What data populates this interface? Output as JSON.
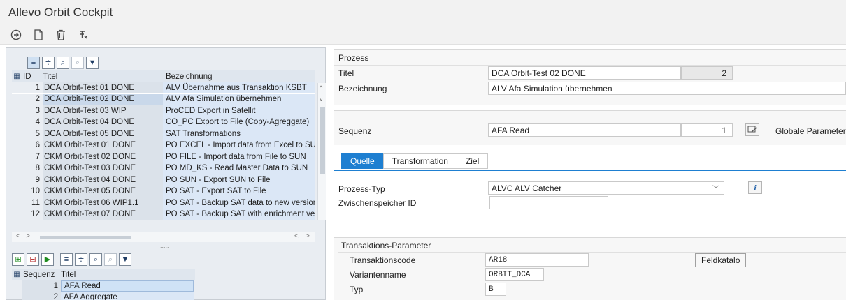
{
  "app": {
    "title": "Allevo Orbit Cockpit"
  },
  "proc_table": {
    "headers": {
      "id": "ID",
      "titel": "Titel",
      "bezeichnung": "Bezeichnung"
    },
    "rows": [
      {
        "id": "1",
        "titel": "DCA Orbit-Test 01 DONE",
        "bezeichnung": "ALV Übernahme aus Transaktion KSBT"
      },
      {
        "id": "2",
        "titel": "DCA Orbit-Test 02 DONE",
        "bezeichnung": "ALV Afa Simulation übernehmen"
      },
      {
        "id": "3",
        "titel": "DCA Orbit-Test 03 WIP",
        "bezeichnung": "ProCED Export in Satellit"
      },
      {
        "id": "4",
        "titel": "DCA Orbit-Test 04 DONE",
        "bezeichnung": "CO_PC Export to File (Copy-Agreggate)"
      },
      {
        "id": "5",
        "titel": "DCA Orbit-Test 05 DONE",
        "bezeichnung": "SAT Transformations"
      },
      {
        "id": "6",
        "titel": "CKM Orbit-Test 01 DONE",
        "bezeichnung": "PO EXCEL - Import data from Excel to SUN"
      },
      {
        "id": "7",
        "titel": "CKM Orbit-Test 02 DONE",
        "bezeichnung": "PO FILE - Import data from File to SUN"
      },
      {
        "id": "8",
        "titel": "CKM Orbit-Test 03 DONE",
        "bezeichnung": "PO MD_KS - Read Master Data to SUN"
      },
      {
        "id": "9",
        "titel": "CKM Orbit-Test 04 DONE",
        "bezeichnung": "PO SUN - Export SUN to File"
      },
      {
        "id": "10",
        "titel": "CKM Orbit-Test 05 DONE",
        "bezeichnung": "PO SAT - Export SAT to File"
      },
      {
        "id": "11",
        "titel": "CKM Orbit-Test 06 WIP1.1",
        "bezeichnung": "PO SAT - Backup SAT data to new version"
      },
      {
        "id": "12",
        "titel": "CKM Orbit-Test 07 DONE",
        "bezeichnung": "PO SAT - Backup SAT with enrichment ver"
      }
    ]
  },
  "seq_table": {
    "headers": {
      "sequenz": "Sequenz",
      "titel": "Titel"
    },
    "rows": [
      {
        "num": "1",
        "titel": "AFA Read"
      },
      {
        "num": "2",
        "titel": "AFA Aggregate"
      }
    ]
  },
  "prozess": {
    "section_title": "Prozess",
    "titel_label": "Titel",
    "titel_value": "DCA Orbit-Test 02 DONE",
    "titel_num": "2",
    "bez_label": "Bezeichnung",
    "bez_value": "ALV Afa Simulation übernehmen"
  },
  "sequenz": {
    "label": "Sequenz",
    "value": "AFA Read",
    "num": "1",
    "globale_label": "Globale Parameter"
  },
  "tabs": [
    {
      "label": "Quelle"
    },
    {
      "label": "Transformation"
    },
    {
      "label": "Ziel"
    }
  ],
  "quelle": {
    "prozess_typ_label": "Prozess-Typ",
    "prozess_typ_value": "ALVC ALV Catcher",
    "zwischen_label": "Zwischenspeicher ID",
    "zwischen_value": ""
  },
  "transaktion": {
    "group_title": "Transaktions-Parameter",
    "code_label": "Transaktionscode",
    "code_value": "AR18",
    "variante_label": "Variantenname",
    "variante_value": "ORBIT_DCA",
    "typ_label": "Typ",
    "typ_value": "B",
    "feldkatalog_label": "Feldkatalo"
  },
  "scroll_glyphs": {
    "up": "^",
    "down": "v",
    "left": "<",
    "right": ">",
    "grip": "....."
  },
  "colors": {
    "accent": "#1e7fd1",
    "row_blue": "#dbe7f6"
  }
}
